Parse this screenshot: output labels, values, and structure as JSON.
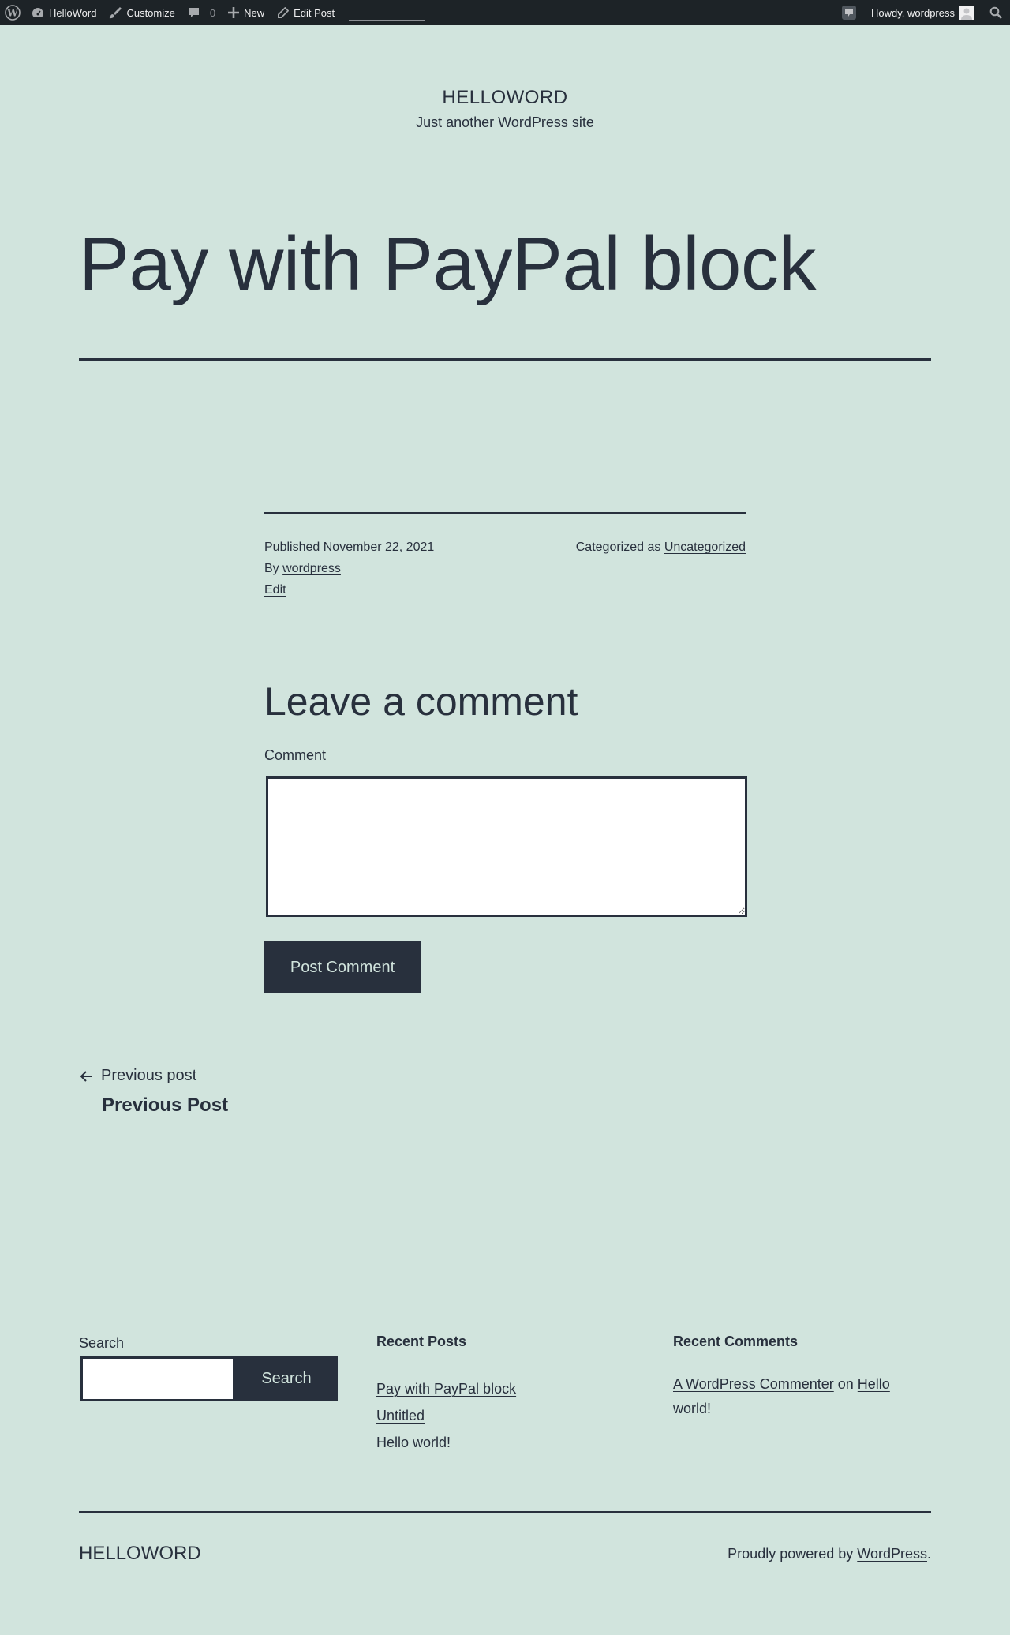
{
  "admin_bar": {
    "wp_logo_icon": "wordpress-logo-icon",
    "site_name": "HelloWord",
    "customize": "Customize",
    "comments_count": "0",
    "new": "New",
    "edit_post": "Edit Post",
    "howdy": "Howdy, wordpress"
  },
  "header": {
    "site_title": "HELLOWORD",
    "tagline": "Just another WordPress site"
  },
  "post": {
    "title": "Pay with PayPal block",
    "published_prefix": "Published",
    "published_date": "November 22, 2021",
    "by_prefix": "By",
    "author": "wordpress",
    "edit": "Edit",
    "categorized_prefix": "Categorized as",
    "category": "Uncategorized"
  },
  "comment_form": {
    "title": "Leave a comment",
    "label": "Comment",
    "value": "",
    "submit": "Post Comment"
  },
  "post_nav": {
    "prev_meta": "Previous post",
    "prev_title": "Previous Post"
  },
  "widgets": {
    "search": {
      "label": "Search",
      "value": "",
      "button": "Search"
    },
    "recent_posts": {
      "title": "Recent Posts",
      "items": [
        "Pay with PayPal block",
        "Untitled",
        "Hello world!"
      ]
    },
    "recent_comments": {
      "title": "Recent Comments",
      "author": "A WordPress Commenter",
      "on": "on",
      "post_line1": "Hello",
      "post_line2": "world!"
    }
  },
  "footer": {
    "site_title": "HELLOWORD",
    "powered_prefix": "Proudly powered by",
    "powered_link": "WordPress",
    "powered_suffix": "."
  },
  "colors": {
    "background": "#d1e4dd",
    "text": "#28303d",
    "admin_bar": "#1d2327"
  }
}
